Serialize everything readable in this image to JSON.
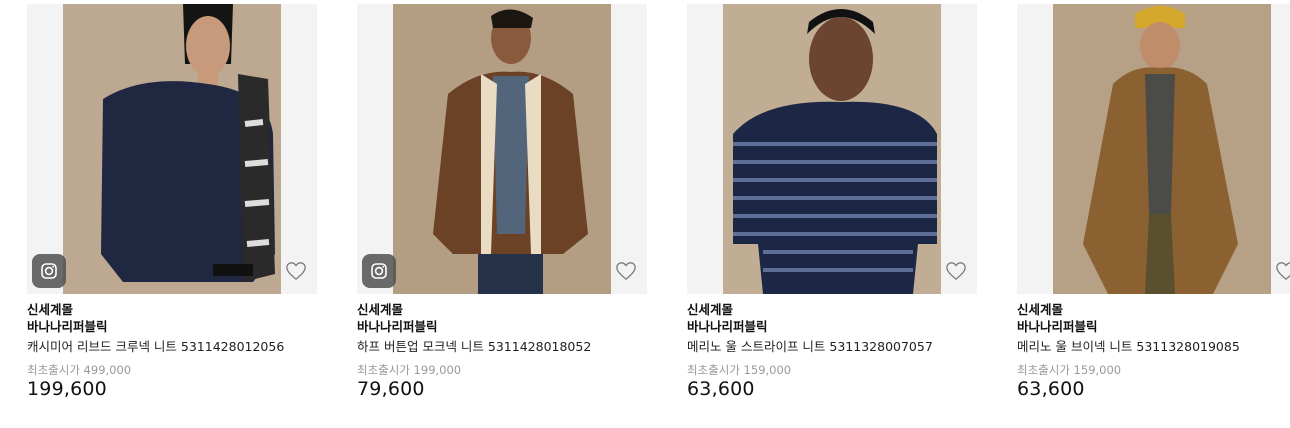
{
  "products": [
    {
      "store": "신세계몰",
      "brand": "바나나리퍼블릭",
      "name": "캐시미어 리브드 크루넥 니트 5311428012056",
      "original_price": "최초출시가 499,000",
      "price": "199,600",
      "instagram_badge": true,
      "wishlist_icon": "heart-outline-icon",
      "colors": {
        "bg": "#bda891",
        "top": "#1f2741",
        "accent": "#2a2a2a",
        "skin": "#c79a7c",
        "hair": "#141414"
      }
    },
    {
      "store": "신세계몰",
      "brand": "바나나리퍼블릭",
      "name": "하프 버튼업 모크넥 니트 5311428018052",
      "original_price": "최초출시가 199,000",
      "price": "79,600",
      "instagram_badge": true,
      "wishlist_icon": "heart-outline-icon",
      "colors": {
        "bg": "#b39d83",
        "top": "#6b4226",
        "accent": "#53657a",
        "skin": "#8a5a3e",
        "hair": "#1c1612"
      }
    },
    {
      "store": "신세계몰",
      "brand": "바나나리퍼블릭",
      "name": "메리노 울 스트라이프 니트 5311328007057",
      "original_price": "최초출시가 159,000",
      "price": "63,600",
      "instagram_badge": false,
      "wishlist_icon": "heart-outline-icon",
      "colors": {
        "bg": "#c1ad94",
        "top": "#1c2745",
        "accent": "#5d6f96",
        "skin": "#6b4532",
        "hair": "#111111"
      }
    },
    {
      "store": "신세계몰",
      "brand": "바나나리퍼블릭",
      "name": "메리노 울 브이넥 니트 5311328019085",
      "original_price": "최초출시가 159,000",
      "price": "63,600",
      "instagram_badge": false,
      "wishlist_icon": "heart-outline-icon",
      "colors": {
        "bg": "#b7a186",
        "top": "#8c6132",
        "accent": "#4b4b47",
        "skin": "#c08d6b",
        "hair": "#d4a82a"
      }
    }
  ]
}
